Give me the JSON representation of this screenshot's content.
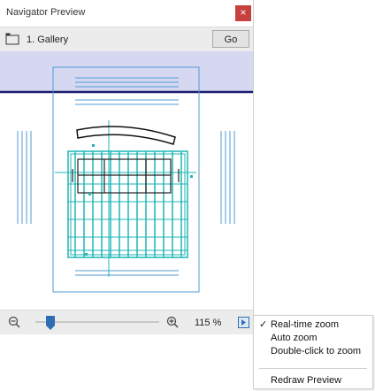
{
  "window": {
    "title": "Navigator Preview",
    "close_label": "×"
  },
  "viewbar": {
    "view_label": "1. Gallery",
    "go_label": "Go"
  },
  "zoombar": {
    "zoom_value": "115 %",
    "slider_fraction": 0.12
  },
  "menu": {
    "items": [
      {
        "label": "Real-time zoom",
        "checked": true,
        "check_mark": "✓"
      },
      {
        "label": "Auto zoom",
        "checked": false
      },
      {
        "label": "Double-click to zoom",
        "checked": false
      },
      {
        "label": "Redraw Preview",
        "checked": false
      }
    ]
  },
  "colors": {
    "plan_cyan": "#1fb5b5",
    "frame_blue": "#4f9bd6",
    "band_lavender": "#d6d7f0",
    "band_line": "#1a1a6e",
    "close_red": "#c6403e",
    "accent_blue": "#2f6db5"
  },
  "icons": [
    "view-icon",
    "close-icon",
    "zoom-out-icon",
    "zoom-in-icon",
    "menu-arrow-icon",
    "check-icon"
  ]
}
